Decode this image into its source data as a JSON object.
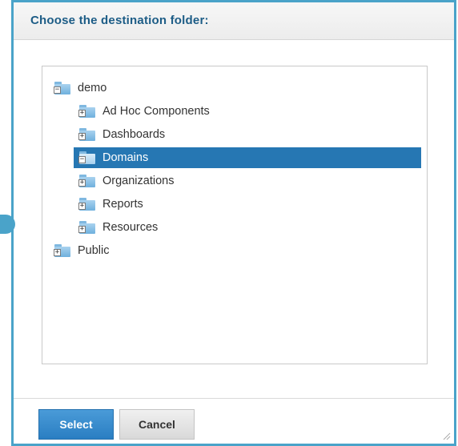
{
  "dialog": {
    "title": "Choose the destination folder:"
  },
  "tree": {
    "items": [
      {
        "label": "demo",
        "expander": "−",
        "selected": false
      },
      {
        "label": "Ad Hoc Components",
        "expander": "+",
        "selected": false
      },
      {
        "label": "Dashboards",
        "expander": "+",
        "selected": false
      },
      {
        "label": "Domains",
        "expander": "−",
        "selected": true
      },
      {
        "label": "Organizations",
        "expander": "+",
        "selected": false
      },
      {
        "label": "Reports",
        "expander": "+",
        "selected": false
      },
      {
        "label": "Resources",
        "expander": "+",
        "selected": false
      },
      {
        "label": "Public",
        "expander": "+",
        "selected": false
      }
    ]
  },
  "buttons": {
    "select_label": "Select",
    "cancel_label": "Cancel"
  },
  "colors": {
    "accent": "#4aa3c9",
    "selection": "#2677b3",
    "title_text": "#1c5c86",
    "primary_button": "#2a7ec2"
  }
}
